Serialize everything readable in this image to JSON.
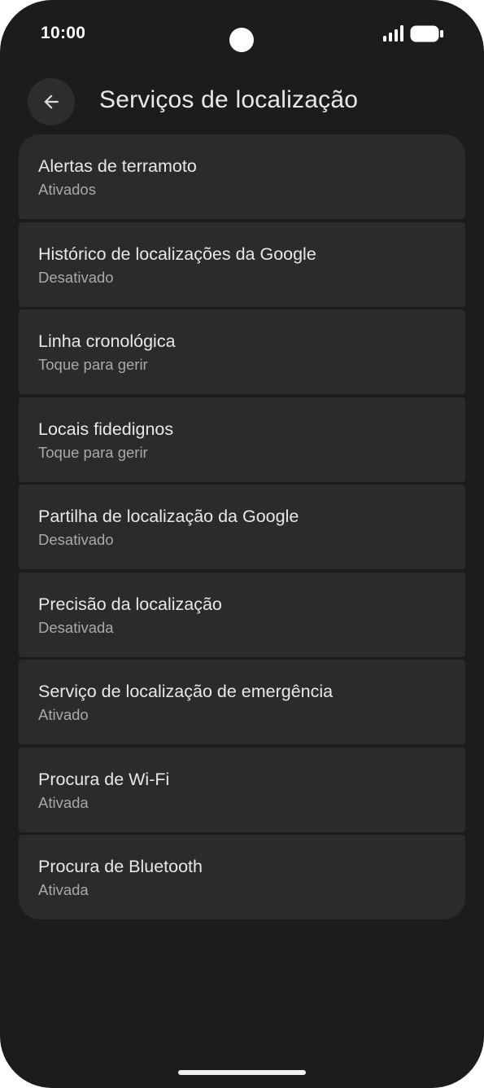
{
  "status_bar": {
    "time": "10:00",
    "signal_icon": "signal-icon",
    "battery_icon": "battery-icon"
  },
  "app_bar": {
    "back_icon": "arrow-back-icon",
    "title": "Serviços de localização"
  },
  "settings": {
    "items": [
      {
        "title": "Alertas de terramoto",
        "summary": "Ativados"
      },
      {
        "title": "Histórico de localizações da Google",
        "summary": "Desativado"
      },
      {
        "title": "Linha cronológica",
        "summary": "Toque para gerir"
      },
      {
        "title": "Locais fidedignos",
        "summary": "Toque para gerir"
      },
      {
        "title": "Partilha de localização da Google",
        "summary": "Desativado"
      },
      {
        "title": "Precisão da localização",
        "summary": "Desativada"
      },
      {
        "title": "Serviço de localização de emergência",
        "summary": "Ativado"
      },
      {
        "title": "Procura de Wi-Fi",
        "summary": "Ativada"
      },
      {
        "title": "Procura de Bluetooth",
        "summary": "Ativada"
      }
    ]
  },
  "colors": {
    "background": "#1b1c1c",
    "card": "#2a2b2b",
    "title_text": "#e8e8e8",
    "summary_text": "#a8a9a9"
  }
}
